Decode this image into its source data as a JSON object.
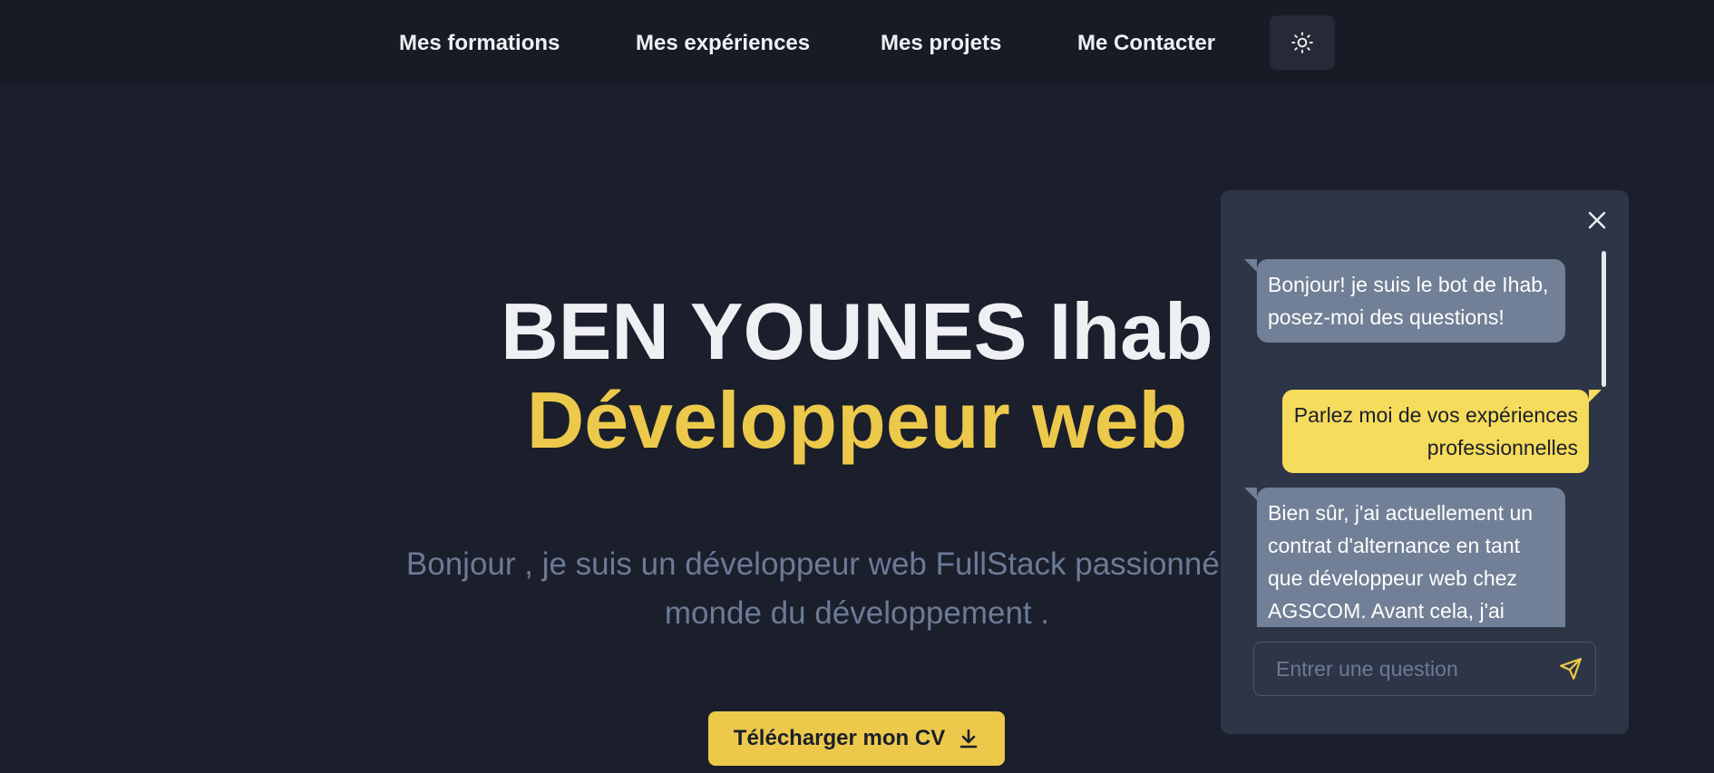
{
  "nav": {
    "items": [
      {
        "label": "Mes formations"
      },
      {
        "label": "Mes expériences"
      },
      {
        "label": "Mes projets"
      },
      {
        "label": "Me Contacter"
      }
    ],
    "theme_icon": "sun-icon"
  },
  "hero": {
    "name": "BEN YOUNES Ihab",
    "role": "Développeur web",
    "description": "Bonjour , je suis un développeur web FullStack passionné par le monde du développement .",
    "cv_button_label": "Télécharger mon CV",
    "cv_button_icon": "download-icon"
  },
  "chat": {
    "close_icon": "close-icon",
    "messages": [
      {
        "from": "bot",
        "text": "Bonjour! je suis le bot de Ihab, posez-moi des questions!"
      },
      {
        "from": "user",
        "text": "Parlez moi de vos expériences professionnelles"
      },
      {
        "from": "bot",
        "text": "Bien sûr, j'ai actuellement un contrat d'alternance en tant que développeur web chez AGSCOM. Avant cela, j'ai"
      }
    ],
    "input_placeholder": "Entrer une question",
    "send_icon": "send-icon"
  },
  "colors": {
    "background": "#1b1f2b",
    "navbar": "#171b25",
    "accent": "#ecc94b",
    "chat_panel": "#2d3546",
    "bot_bubble": "#718096",
    "user_bubble": "#f6dc5c",
    "muted_text": "#6c7a96"
  }
}
